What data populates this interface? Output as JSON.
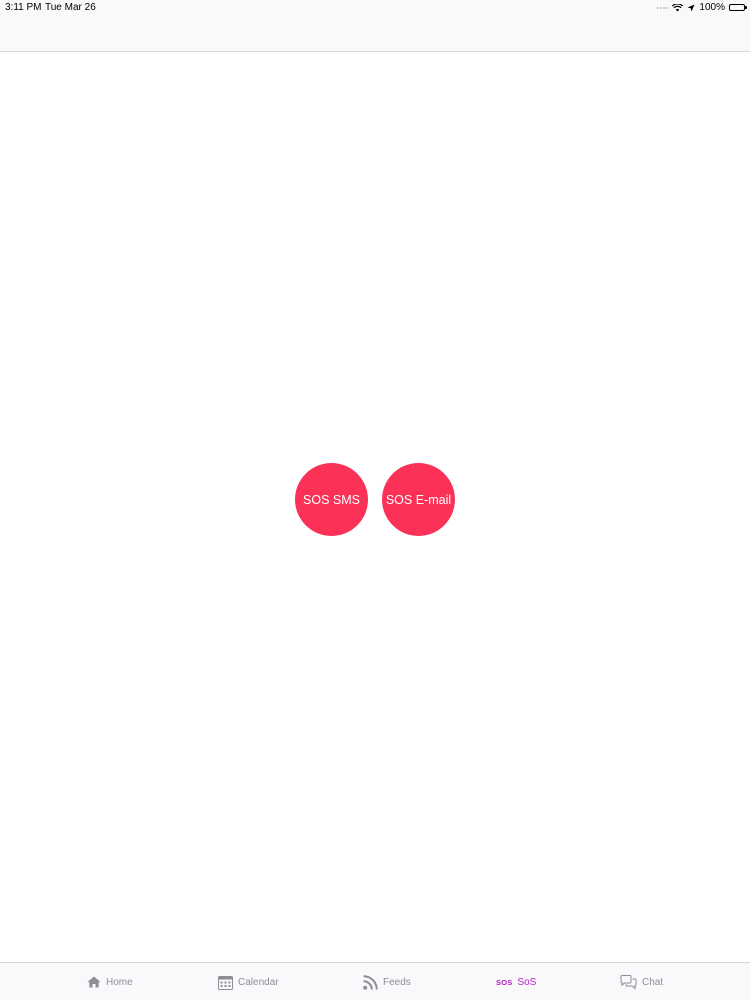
{
  "status_bar": {
    "time": "3:11 PM",
    "date": "Tue Mar 26",
    "battery": "100%",
    "battery_level": 1.0
  },
  "buttons": {
    "sms_label": "SOS SMS",
    "email_label": "SOS E-mail"
  },
  "tabs": [
    {
      "label": "Home",
      "icon": "home-icon",
      "active": false
    },
    {
      "label": "Calendar",
      "icon": "calendar-icon",
      "active": false
    },
    {
      "label": "Feeds",
      "icon": "rss-feed-icon",
      "active": false
    },
    {
      "label": "SoS",
      "icon": "sos-icon",
      "icon_text": "SOS",
      "active": true
    },
    {
      "label": "Chat",
      "icon": "chat-bubbles-icon",
      "active": false
    }
  ],
  "colors": {
    "sos_button": "#fb3158",
    "active_tab": "#b21fc3",
    "inactive_tab": "#8e8e93",
    "bar_background": "#f9f8fb"
  }
}
